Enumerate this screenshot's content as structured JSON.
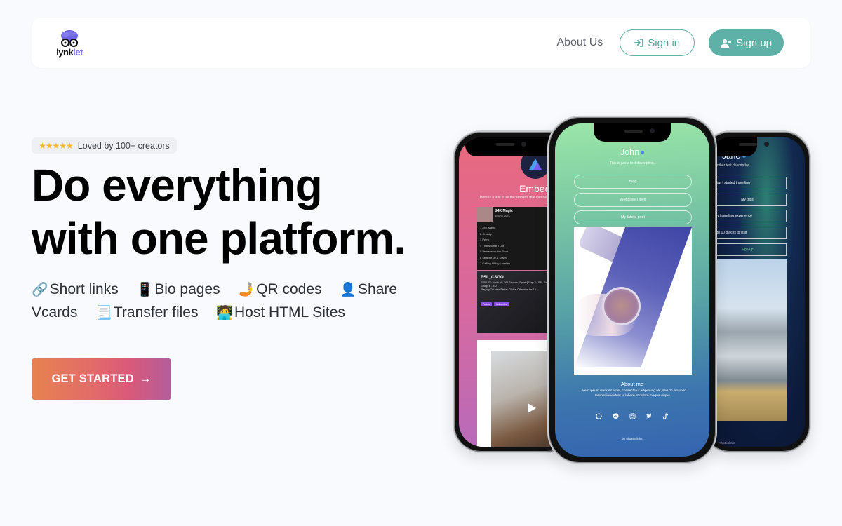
{
  "navbar": {
    "logo": {
      "text_part1": "lynk",
      "text_part2": "let",
      "icon": "brain-glasses-logo"
    },
    "about_label": "About Us",
    "signin_label": "Sign in",
    "signin_icon": "sign-in-icon",
    "signup_label": "Sign up",
    "signup_icon": "user-plus-icon"
  },
  "hero": {
    "badge": {
      "stars": "★★★★★",
      "rating": 5,
      "text": "Loved by 100+ creators"
    },
    "title_line1": "Do everything",
    "title_line2": "with one platform.",
    "features": [
      {
        "emoji": "🔗",
        "icon": "link-icon",
        "label": "Short links"
      },
      {
        "emoji": "📱",
        "icon": "mobile-phone-icon",
        "label": "Bio pages"
      },
      {
        "emoji": "🤳",
        "icon": "selfie-icon",
        "label": "QR codes"
      },
      {
        "emoji": "👤",
        "icon": "user-silhouette-icon",
        "label": "Share Vcards"
      },
      {
        "emoji": "📃",
        "icon": "page-curl-icon",
        "label": "Transfer files"
      },
      {
        "emoji": "🧑‍💻",
        "icon": "technologist-icon",
        "label": "Host HTML Sites"
      }
    ],
    "cta_label": "GET STARTED",
    "cta_icon": "→"
  },
  "phones": {
    "left": {
      "title": "Embeds",
      "subtitle": "Here is a test of all the embeds that can be added",
      "spotify": {
        "song": "24K Magic",
        "artist": "Bruno Mars",
        "tracks": [
          "1  24K Magic",
          "2  Chunky",
          "3  Perm",
          "4  That's What I Like",
          "5  Versace on the Floor",
          "6  Straight up & Down",
          "7  Calling All My Lovelies"
        ]
      },
      "twitch": {
        "channel": "ESL_CSGO",
        "description": "REPLAY: North NL DIV Esports [Sports] Map 2 - ESL Pro 2020 Online - Group B - EU",
        "playing": "Playing Counter-Strike: Global Offensive for 14...",
        "follow_label": "Follow",
        "subscribe_label": "Subscribe"
      }
    },
    "center": {
      "name": "John",
      "subtitle": "This is just a test description.",
      "links": [
        "Blog",
        "Websites I love",
        "My latest post"
      ],
      "about_title": "About me",
      "about_text": "Lorem ipsum dolor sit amet, consectetur adipiscing elit, sed do eiusmod tempor incididunt ut labore et dolore magna aliqua.",
      "social_icons": [
        "whatsapp-icon",
        "messenger-icon",
        "instagram-icon",
        "twitter-icon",
        "tiktok-icon"
      ],
      "footer": "by phpBiolinks"
    },
    "right": {
      "name": "Jane",
      "subtitle": "Is another test description.",
      "links": [
        "How I started travelling",
        "My trips",
        "My travelling experience",
        "Top 10 places to visit",
        "Sign up"
      ],
      "footer": "by phpBiolinks"
    }
  }
}
